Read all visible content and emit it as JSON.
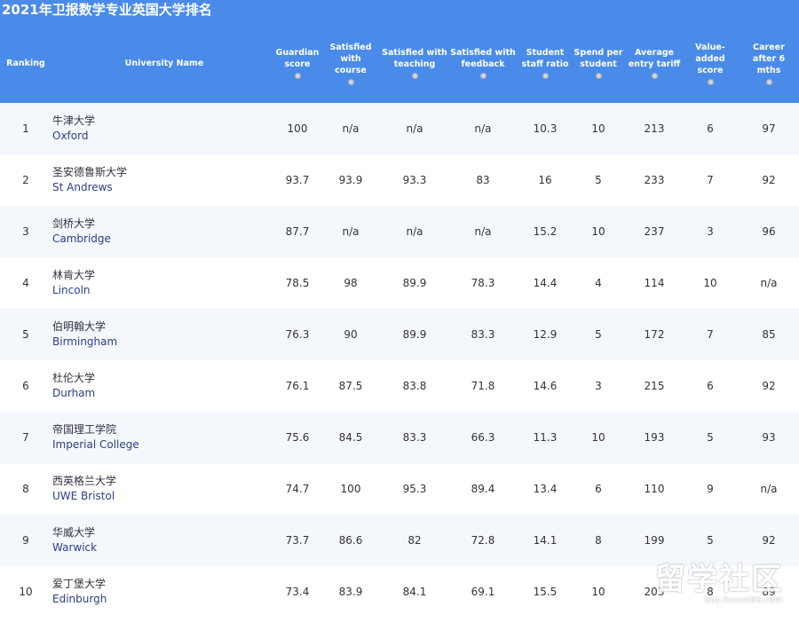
{
  "page": {
    "title": "2021年卫报数学专业英国大学排名"
  },
  "columns": [
    {
      "key": "rank",
      "label": "Ranking",
      "icon": false
    },
    {
      "key": "name",
      "label": "University Name",
      "icon": false
    },
    {
      "key": "score",
      "label": "Guardian\nscore",
      "icon": true
    },
    {
      "key": "course",
      "label": "Satisfied\nwith course",
      "icon": true
    },
    {
      "key": "teaching",
      "label": "Satisfied with\nteaching",
      "icon": true
    },
    {
      "key": "feedback",
      "label": "Satisfied with\nfeedback",
      "icon": true
    },
    {
      "key": "ratio",
      "label": "Student\nstaff ratio",
      "icon": true
    },
    {
      "key": "spend",
      "label": "Spend per\nstudent",
      "icon": true
    },
    {
      "key": "tariff",
      "label": "Average\nentry tariff",
      "icon": true
    },
    {
      "key": "value",
      "label": "Value-\nadded\nscore",
      "icon": true
    },
    {
      "key": "career",
      "label": "Career\nafter 6\nmths",
      "icon": true
    }
  ],
  "rows": [
    {
      "rank": "1",
      "cn": "牛津大学",
      "en": "Oxford",
      "score": "100",
      "course": "n/a",
      "teaching": "n/a",
      "feedback": "n/a",
      "ratio": "10.3",
      "spend": "10",
      "tariff": "213",
      "value": "6",
      "career": "97"
    },
    {
      "rank": "2",
      "cn": "圣安德鲁斯大学",
      "en": "St Andrews",
      "score": "93.7",
      "course": "93.9",
      "teaching": "93.3",
      "feedback": "83",
      "ratio": "16",
      "spend": "5",
      "tariff": "233",
      "value": "7",
      "career": "92"
    },
    {
      "rank": "3",
      "cn": "剑桥大学",
      "en": "Cambridge",
      "score": "87.7",
      "course": "n/a",
      "teaching": "n/a",
      "feedback": "n/a",
      "ratio": "15.2",
      "spend": "10",
      "tariff": "237",
      "value": "3",
      "career": "96"
    },
    {
      "rank": "4",
      "cn": "林肯大学",
      "en": "Lincoln",
      "score": "78.5",
      "course": "98",
      "teaching": "89.9",
      "feedback": "78.3",
      "ratio": "14.4",
      "spend": "4",
      "tariff": "114",
      "value": "10",
      "career": "n/a"
    },
    {
      "rank": "5",
      "cn": "伯明翰大学",
      "en": "Birmingham",
      "score": "76.3",
      "course": "90",
      "teaching": "89.9",
      "feedback": "83.3",
      "ratio": "12.9",
      "spend": "5",
      "tariff": "172",
      "value": "7",
      "career": "85"
    },
    {
      "rank": "6",
      "cn": "杜伦大学",
      "en": "Durham",
      "score": "76.1",
      "course": "87.5",
      "teaching": "83.8",
      "feedback": "71.8",
      "ratio": "14.6",
      "spend": "3",
      "tariff": "215",
      "value": "6",
      "career": "92"
    },
    {
      "rank": "7",
      "cn": "帝国理工学院",
      "en": "Imperial College",
      "score": "75.6",
      "course": "84.5",
      "teaching": "83.3",
      "feedback": "66.3",
      "ratio": "11.3",
      "spend": "10",
      "tariff": "193",
      "value": "5",
      "career": "93"
    },
    {
      "rank": "8",
      "cn": "西英格兰大学",
      "en": "UWE Bristol",
      "score": "74.7",
      "course": "100",
      "teaching": "95.3",
      "feedback": "89.4",
      "ratio": "13.4",
      "spend": "6",
      "tariff": "110",
      "value": "9",
      "career": "n/a"
    },
    {
      "rank": "9",
      "cn": "华威大学",
      "en": "Warwick",
      "score": "73.7",
      "course": "86.6",
      "teaching": "82",
      "feedback": "72.8",
      "ratio": "14.1",
      "spend": "8",
      "tariff": "199",
      "value": "5",
      "career": "92"
    },
    {
      "rank": "10",
      "cn": "爱丁堡大学",
      "en": "Edinburgh",
      "score": "73.4",
      "course": "83.9",
      "teaching": "84.1",
      "feedback": "69.1",
      "ratio": "15.5",
      "spend": "10",
      "tariff": "203",
      "value": "8",
      "career": "89"
    }
  ],
  "watermark": {
    "logo": "留学社区",
    "url": "bbs.liuxue86.com"
  }
}
